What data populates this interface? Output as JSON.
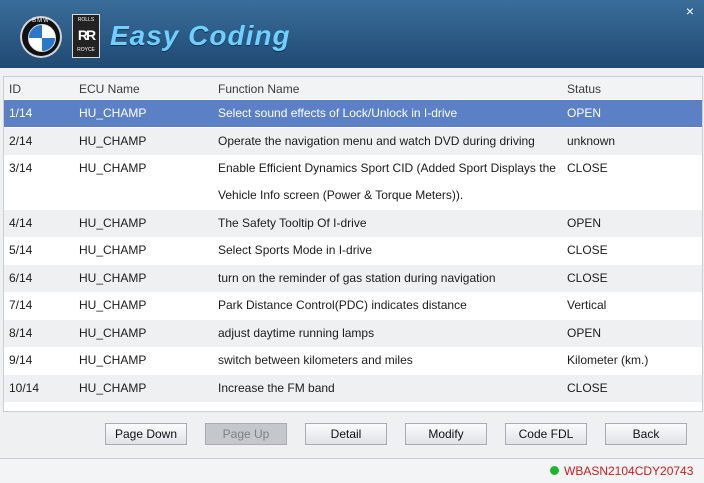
{
  "app": {
    "brand": "Easy Coding"
  },
  "header": {
    "close_glyph": "×",
    "bmw_letters": "BMW",
    "rr_top": "ROLLS",
    "rr_mid": "RR",
    "rr_bot": "ROYCE"
  },
  "table": {
    "headers": {
      "id": "ID",
      "ecu": "ECU Name",
      "fn": "Function Name",
      "status": "Status"
    },
    "rows": [
      {
        "id": "1/14",
        "ecu": "HU_CHAMP",
        "fn": "Select sound effects of Lock/Unlock in I-drive",
        "status": "OPEN"
      },
      {
        "id": "2/14",
        "ecu": "HU_CHAMP",
        "fn": "Operate the navigation menu and watch DVD during driving",
        "status": "unknown"
      },
      {
        "id": "3/14",
        "ecu": "HU_CHAMP",
        "fn": "Enable Efficient Dynamics Sport CID (Added Sport Displays the Vehicle Info screen (Power & Torque Meters)).",
        "status": "CLOSE"
      },
      {
        "id": "4/14",
        "ecu": "HU_CHAMP",
        "fn": "The Safety Tooltip Of I-drive",
        "status": "OPEN"
      },
      {
        "id": "5/14",
        "ecu": "HU_CHAMP",
        "fn": "Select Sports Mode in I-drive",
        "status": "CLOSE"
      },
      {
        "id": "6/14",
        "ecu": "HU_CHAMP",
        "fn": "turn on the reminder of gas station during navigation",
        "status": "CLOSE"
      },
      {
        "id": "7/14",
        "ecu": "HU_CHAMP",
        "fn": "Park Distance Control(PDC) indicates distance",
        "status": "Vertical"
      },
      {
        "id": "8/14",
        "ecu": "HU_CHAMP",
        "fn": "adjust daytime running lamps",
        "status": "OPEN"
      },
      {
        "id": "9/14",
        "ecu": "HU_CHAMP",
        "fn": "switch between kilometers and miles",
        "status": "Kilometer (km.)"
      },
      {
        "id": "10/14",
        "ecu": "HU_CHAMP",
        "fn": "Increase the FM band",
        "status": "CLOSE"
      }
    ]
  },
  "buttons": {
    "page_down": "Page Down",
    "page_up": "Page Up",
    "detail": "Detail",
    "modify": "Modify",
    "code_fdl": "Code FDL",
    "back": "Back"
  },
  "status": {
    "vin": "WBASN2104CDY20743",
    "dot_color": "#1bb52b"
  },
  "colors": {
    "selected_row": "#5b80c6",
    "header_bg": "#2a5a86",
    "vin_text": "#d11a1a"
  }
}
